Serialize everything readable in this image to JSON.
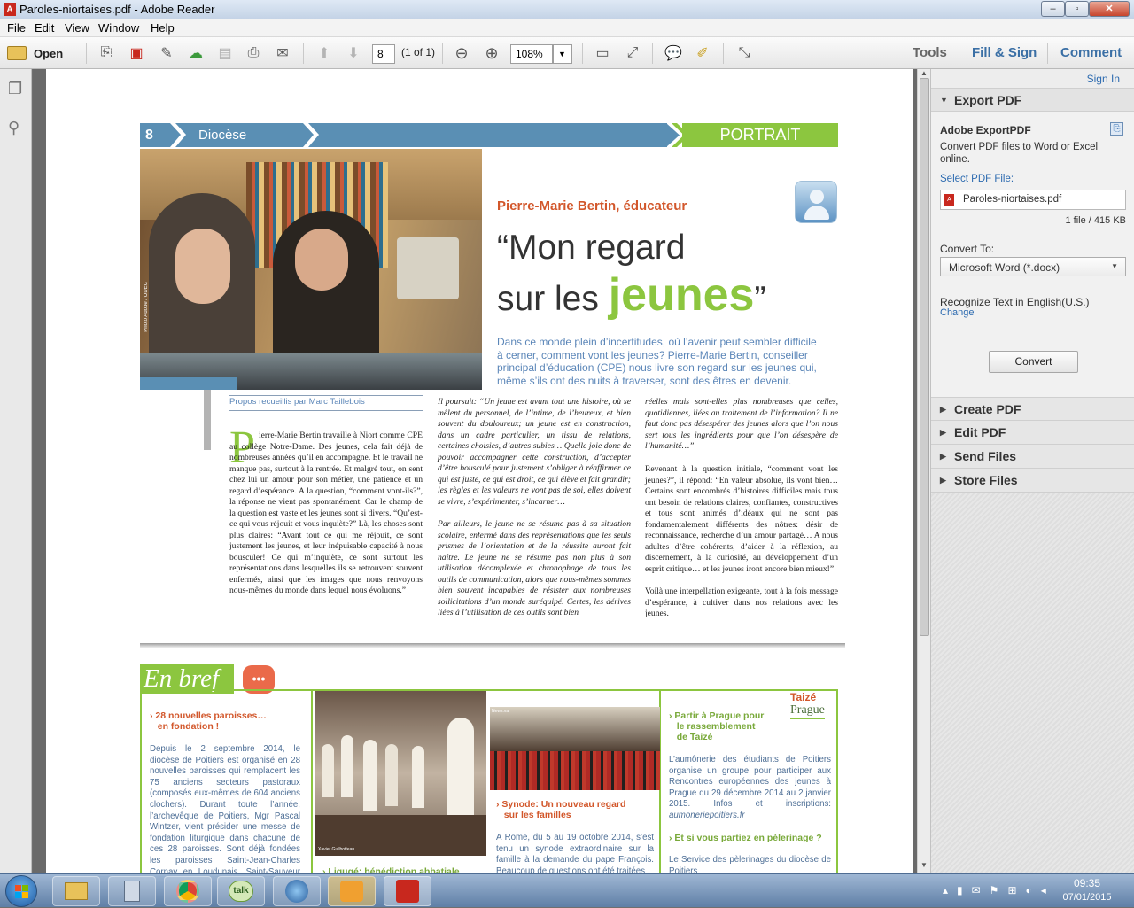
{
  "window": {
    "title": "Paroles-niortaises.pdf - Adobe Reader",
    "minimize": "–",
    "maximize": "▫",
    "close": "✕"
  },
  "menu": [
    "File",
    "Edit",
    "View",
    "Window",
    "Help"
  ],
  "toolbar": {
    "open_label": "Open",
    "page_input": "8",
    "page_count": "(1 of 1)",
    "zoom": "108%",
    "tools": "Tools",
    "fill_sign": "Fill & Sign",
    "comment": "Comment"
  },
  "panel": {
    "sign_in": "Sign In",
    "export_pdf": "Export PDF",
    "adobe_exportpdf": "Adobe ExportPDF",
    "export_desc": "Convert PDF files to Word or Excel online.",
    "select_pdf_file": "Select PDF File:",
    "selected_file": "Paroles-niortaises.pdf",
    "file_info": "1 file / 415 KB",
    "convert_to": "Convert To:",
    "format": "Microsoft Word (*.docx)",
    "recognize": "Recognize Text in English(U.S.)",
    "change": "Change",
    "convert_button": "Convert",
    "sections": [
      "Create PDF",
      "Edit PDF",
      "Send Files",
      "Store Files"
    ]
  },
  "document": {
    "page_number": "8",
    "section": "Diocèse",
    "portrait": "PORTRAIT",
    "byline": "Pierre-Marie Bertin, éducateur",
    "headline_1": "“Mon regard",
    "headline_2a": "sur les ",
    "headline_2b": "jeunes",
    "headline_2c": "”",
    "photo_credit": "Photo Adobe / ODEC",
    "lead": "Dans ce monde plein d’incertitudes, où l’avenir peut sembler difficile à cerner, comment vont les jeunes? Pierre-Marie Bertin, conseiller principal d’éducation (CPE) nous livre son regard sur les jeunes qui, même s’ils ont des nuits à traverser, sont des êtres en devenir.",
    "credit": "Propos recueillis par Marc Taillebois",
    "dropcap": "P",
    "col1": "ierre-Marie Bertin travaille à Niort comme CPE au collège Notre-Dame. Des jeunes, cela fait déjà de nombreuses années qu’il en accompagne. Et le travail ne manque pas, surtout à la rentrée. Et malgré tout, on sent chez lui un amour pour son métier, une patience et un regard d’espérance. A la question, “comment vont-ils?”, la réponse ne vient pas spontanément. Car le champ de la question est vaste et les jeunes sont si divers. “Qu’est-ce qui vous réjouit et vous inquiète?” Là, les choses sont plus claires: “Avant tout ce qui me réjouit, ce sont justement les jeunes, et leur inépuisable capacité à nous bousculer! Ce qui m’inquiète, ce sont surtout les représentations dans lesquelles ils se retrouvent souvent enfermés, ainsi que les images que nous renvoyons nous-mêmes du monde dans lequel nous évoluons.”",
    "col2a": "Il poursuit: “Un jeune est avant tout une histoire, où se mêlent du personnel, de l’intime, de l’heureux, et bien souvent du douloureux; un jeune est en construction, dans un cadre particulier, un tissu de relations, certaines choisies, d’autres subies… Quelle joie donc de pouvoir accompagner cette construction, d’accepter d’être bousculé pour justement s’obliger à réaffirmer ce qui est juste, ce qui est droit, ce qui élève et fait grandir; les règles et les valeurs ne vont pas de soi, elles doivent se vivre, s’expérimenter, s’incarner…",
    "col2b": "Par ailleurs, le jeune ne se résume pas à sa situation scolaire, enfermé dans des représentations que les seuls prismes de l’orientation et de la réussite auront fait naître. Le jeune ne se résume pas non plus à son utilisation décomplexée et chronophage de tous les outils de communication, alors que nous-mêmes sommes bien souvent incapables de résister aux nombreuses sollicitations d’un monde suréquipé. Certes, les dérives liées à l’utilisation de ces outils sont bien",
    "col3a": "réelles mais sont-elles plus nombreuses que celles, quotidiennes, liées au traitement de l’information? Il ne faut donc pas désespérer des jeunes alors que l’on nous sert tous les ingrédients pour que l’on désespère de l’humanité…”",
    "col3b": "Revenant à la question initiale, “comment vont les jeunes?”, il répond: “En valeur absolue, ils vont bien… Certains sont encombrés d’histoires difficiles mais tous ont besoin de relations claires, confiantes, constructives et tous sont animés d’idéaux qui ne sont pas fondamentalement différents des nôtres: désir de reconnaissance, recherche d’un amour partagé… A nous adultes d’être cohérents, d’aider à la réflexion, au discernement, à la curiosité, au développement d’un esprit critique… et les jeunes iront encore bien mieux!”",
    "col3c": "Voilà une interpellation exigeante, tout à la fois message d’espérance, à cultiver dans nos relations avec les jeunes.",
    "enbref": "En bref",
    "enbref_icon": "•••",
    "b1_title": "› 28 nouvelles paroisses…\n   en fondation !",
    "b1_text": "Depuis le 2 septembre 2014, le diocèse de Poitiers est organisé en 28 nouvelles paroisses qui remplacent les 75 anciens secteurs pastoraux (composés eux-mêmes de 604 anciens clochers). Durant toute l’année, l’archevêque de Poitiers, Mgr Pascal Wintzer, vient présider une messe de fondation liturgique dans chacune de ces 28 paroisses. Sont déjà fondées les paroisses Saint-Jean-Charles Cornay en Loudunais, Saint-Sauveur en Civraisien",
    "b2_caption": "Xavier Guilbotteau",
    "b2_title": "› Ligugé: bénédiction abbatiale",
    "b3_credit": "News.va",
    "b3_title": "› Synode: Un nouveau regard\n   sur les familles",
    "b3_text": "A Rome, du 5 au 19 octobre 2014, s’est tenu un synode extraordinaire sur la famille à la demande du pape François. Beaucoup de questions ont été traitées",
    "taize": "Taizé",
    "prague": "Prague",
    "b4_title": "› Partir à Prague pour\n   le rassemblement\n   de Taizé",
    "b4_text": "L’aumônerie des étudiants de Poitiers organise un groupe pour participer aux Rencontres européennes des jeunes à Prague du 29 décembre 2014 au 2 janvier 2015. Infos et inscriptions: ",
    "b4_link": "aumoneriepoitiers.fr",
    "b5_title": "› Et si vous partiez en pèlerinage ?",
    "b5_text": "Le Service des pèlerinages du diocèse de Poitiers"
  },
  "taskbar": {
    "time": "09:35",
    "date": "07/01/2015"
  }
}
